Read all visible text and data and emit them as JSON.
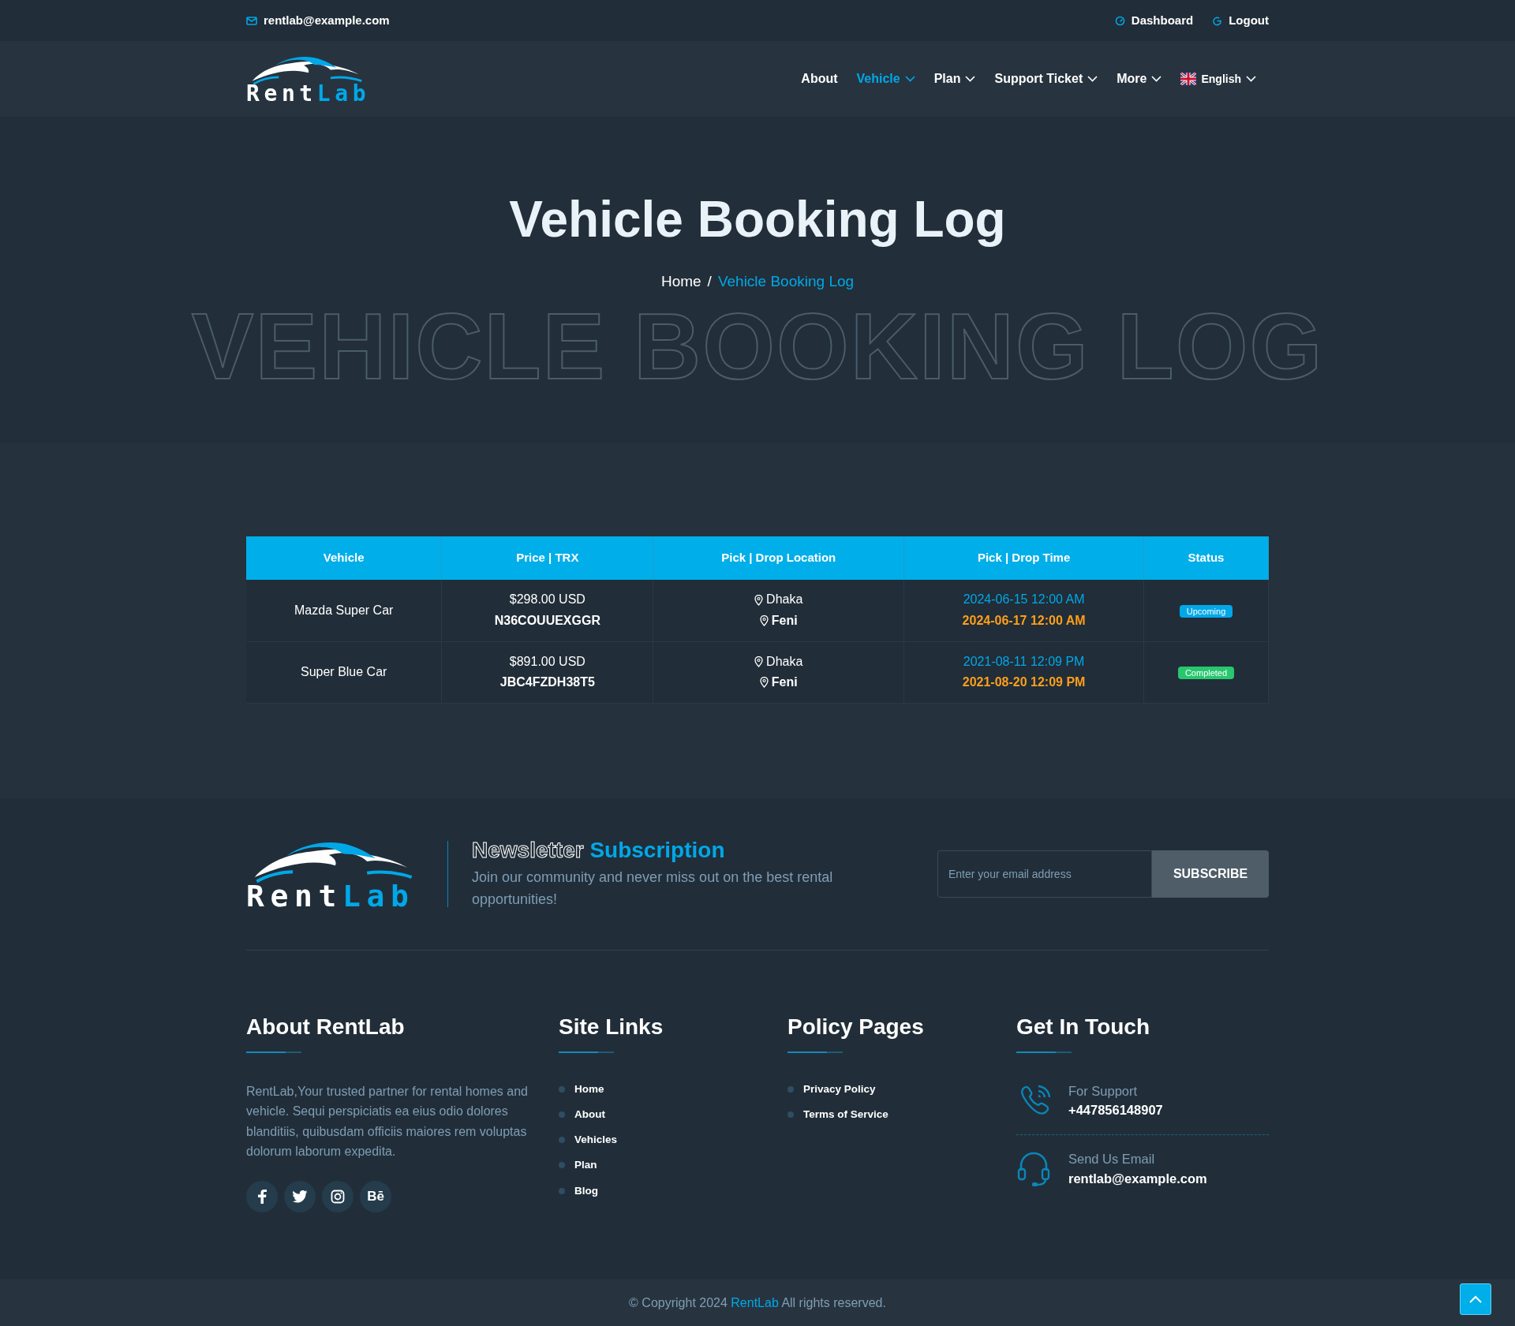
{
  "topbar": {
    "email": "rentlab@example.com",
    "links": [
      {
        "kind": "dashboard",
        "label": "Dashboard"
      },
      {
        "kind": "logout",
        "label": "Logout"
      }
    ]
  },
  "logo": {
    "first": "Rent",
    "second": "Lab"
  },
  "nav": [
    {
      "label": "About",
      "dropdown": false,
      "selected": false,
      "kind": "link"
    },
    {
      "label": "Vehicle",
      "dropdown": true,
      "selected": true,
      "kind": "link"
    },
    {
      "label": "Plan",
      "dropdown": true,
      "selected": false,
      "kind": "link"
    },
    {
      "label": "Support Ticket",
      "dropdown": true,
      "selected": false,
      "kind": "link"
    },
    {
      "label": "More",
      "dropdown": true,
      "selected": false,
      "kind": "link"
    },
    {
      "label": "English",
      "dropdown": true,
      "selected": false,
      "kind": "language"
    }
  ],
  "hero": {
    "title": "Vehicle Booking Log",
    "background_text": "VEHICLE BOOKING LOG",
    "breadcrumb": [
      {
        "label": "Home",
        "selected": false
      },
      {
        "label": "Vehicle Booking Log",
        "selected": true
      }
    ],
    "separator": "/"
  },
  "table": {
    "columns": [
      "Vehicle",
      "Price | TRX",
      "Pick | Drop Location",
      "Pick | Drop Time",
      "Status"
    ],
    "rows": [
      {
        "vehicle": "Mazda Super Car",
        "price": "$298.00 USD",
        "trx": "N36COUUEXGGR",
        "pick_location": "Dhaka",
        "drop_location": "Feni",
        "pick_time": "2024-06-15 12:00 AM",
        "drop_time": "2024-06-17 12:00 AM",
        "status": {
          "label": "Upcoming",
          "color": "#00a8e8"
        }
      },
      {
        "vehicle": "Super Blue Car",
        "price": "$891.00 USD",
        "trx": "JBC4FZDH38T5",
        "pick_location": "Dhaka",
        "drop_location": "Feni",
        "pick_time": "2021-08-11 12:09 PM",
        "drop_time": "2021-08-20 12:09 PM",
        "status": {
          "label": "Completed",
          "color": "#28c76f"
        }
      }
    ]
  },
  "footer_logo": {
    "first": "Rent",
    "second": "Lab"
  },
  "newsletter": {
    "title_1": "Newsletter",
    "title_2": "Subscription",
    "text": "Join our community and never miss out on the best rental opportunities!",
    "placeholder": "Enter your email address",
    "button": "SUBSCRIBE"
  },
  "about": {
    "title": "About RentLab",
    "text": "RentLab,Your trusted partner for rental homes and vehicle. Sequi perspiciatis ea eius odio dolores blanditiis, quibusdam officiis maiores rem voluptas dolorum laborum expedita.",
    "socials": [
      {
        "kind": "facebook"
      },
      {
        "kind": "twitter"
      },
      {
        "kind": "instagram"
      },
      {
        "kind": "behance",
        "label": "Bē"
      }
    ]
  },
  "site_links": {
    "title": "Site Links",
    "items": [
      "Home",
      "About",
      "Vehicles",
      "Plan",
      "Blog"
    ]
  },
  "policy": {
    "title": "Policy Pages",
    "items": [
      "Privacy Policy",
      "Terms of Service"
    ]
  },
  "contact": {
    "title": "Get In Touch",
    "items": [
      {
        "kind": "phone",
        "label": "For Support",
        "value": "+447856148907"
      },
      {
        "kind": "email",
        "label": "Send Us Email",
        "value": "rentlab@example.com"
      }
    ]
  },
  "copyright": {
    "before": "© Copyright 2024",
    "brand": "RentLab",
    "after": "All rights reserved."
  }
}
